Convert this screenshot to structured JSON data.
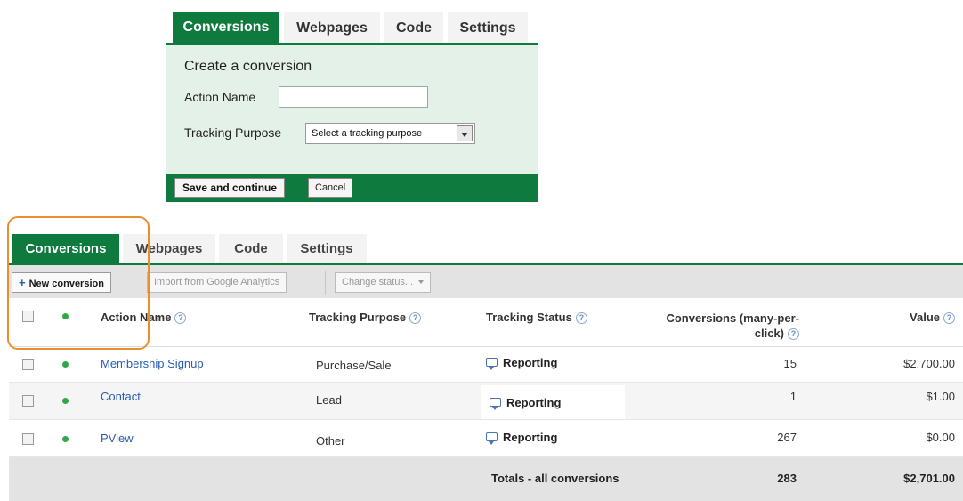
{
  "top_panel": {
    "tabs": [
      {
        "label": "Conversions",
        "active": true
      },
      {
        "label": "Webpages",
        "active": false
      },
      {
        "label": "Code",
        "active": false
      },
      {
        "label": "Settings",
        "active": false
      }
    ],
    "title": "Create a conversion",
    "action_name_label": "Action Name",
    "action_name_value": "",
    "tracking_purpose_label": "Tracking Purpose",
    "tracking_purpose_selected": "Select a tracking purpose",
    "save_label": "Save and continue",
    "cancel_label": "Cancel"
  },
  "bottom_panel": {
    "tabs": [
      {
        "label": "Conversions",
        "active": true
      },
      {
        "label": "Webpages",
        "active": false
      },
      {
        "label": "Code",
        "active": false
      },
      {
        "label": "Settings",
        "active": false
      }
    ],
    "toolbar": {
      "new_conversion": "New conversion",
      "import_analytics": "Import from Google Analytics",
      "change_status": "Change status..."
    },
    "columns": {
      "action_name": "Action Name",
      "tracking_purpose": "Tracking Purpose",
      "tracking_status": "Tracking Status",
      "conversions": "Conversions (many-per-click)",
      "value": "Value"
    },
    "help_glyph": "?",
    "rows": [
      {
        "name": "Membership Signup",
        "purpose": "Purchase/Sale",
        "status": "Reporting",
        "conversions": "15",
        "value": "$2,700.00"
      },
      {
        "name": "Contact",
        "purpose": "Lead",
        "status": "Reporting",
        "conversions": "1",
        "value": "$1.00"
      },
      {
        "name": "PView",
        "purpose": "Other",
        "status": "Reporting",
        "conversions": "267",
        "value": "$0.00"
      }
    ],
    "totals": {
      "label": "Totals - all conversions",
      "conversions": "283",
      "value": "$2,701.00"
    }
  },
  "colors": {
    "brand_green": "#0f7a3e",
    "panel_light_green": "#e4f1e8",
    "link_blue": "#2a5db0",
    "status_dot": "#2fa84a",
    "highlight_orange": "#e8902e"
  }
}
